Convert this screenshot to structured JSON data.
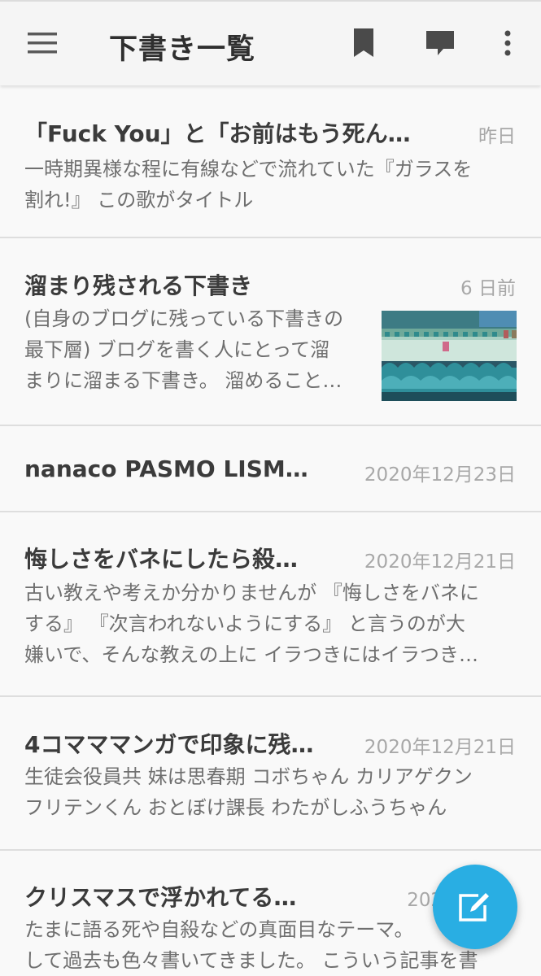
{
  "appbar": {
    "title": "下書き一覧",
    "icons": [
      "menu-icon",
      "bookmark-icon",
      "comment-icon",
      "more-vert-icon"
    ]
  },
  "drafts": [
    {
      "title": "「Fuck You」と「お前はもう死ん…",
      "date": "昨日",
      "excerpt": [
        "一時期異様な程に有線などで流れていた『ガラスを",
        "割れ!』 この歌がタイトル"
      ]
    },
    {
      "title": "溜まり残される下書き",
      "date": "6 日前",
      "excerpt": [
        "(自身のブログに残っている下書きの",
        "最下層) ブログを書く人にとって溜",
        "まりに溜まる下書き。 溜めること…"
      ],
      "has_thumbnail": true
    },
    {
      "title": "nanaco PASMO LISMO…",
      "date": "2020年12月23日",
      "excerpt": []
    },
    {
      "title": "悔しさをバネにしたら殺…",
      "date": "2020年12月21日",
      "excerpt": [
        "古い教えや考えか分かりませんが 『悔しさをバネに",
        "する』 『次言われないようにする』 と言うのが大",
        "嫌いで、そんな教えの上に イラつきにはイラつき…"
      ]
    },
    {
      "title": "4コマママンガで印象に残…",
      "date": "2020年12月21日",
      "excerpt": [
        "生徒会役員共 妹は思春期 コボちゃん カリアゲクン",
        "フリテンくん おとぼけ課長 わたがしふうちゃん"
      ]
    },
    {
      "title": "クリスマスで浮かれてる…",
      "date": "2020年12月",
      "excerpt": [
        "たまに語る死や自殺などの真面目なテーマ。",
        "して過去も色々書いてきました。 こういう記事を書"
      ]
    }
  ],
  "fab": {
    "icon": "edit-icon"
  },
  "colors": {
    "accent": "#29aee3",
    "appbar_bg": "#f5f5f5",
    "icon": "#5a5a5a",
    "title_text": "#3b3b3b",
    "excerpt_text": "#6f6f6f",
    "date_text": "#a8a8a8"
  }
}
